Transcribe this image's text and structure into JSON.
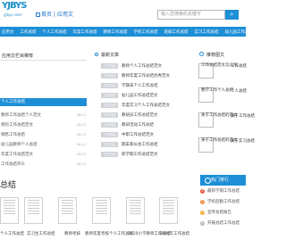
{
  "header": {
    "logo_text": "YJBYS",
    "logo_sub": "yjbys.com",
    "home_label": "首页 | 应用文",
    "search_placeholder": "输入您搜索的关键字",
    "search_button": "⌕"
  },
  "nav": [
    "应用文",
    "工作总结",
    "个人工作总结",
    "年度工作总结",
    "教师工作总结",
    "学校工作总结",
    "班级工作总结",
    "实习工作总结",
    "幼儿园工作总结",
    "班主任工作"
  ],
  "left": {
    "title": "应用文栏目推荐",
    "highlight": "个人工作总结",
    "items": [
      {
        "text": "教师工作总结个人范文",
        "date": "08-11"
      },
      {
        "text": "保险工作总结范文",
        "date": "08-11"
      },
      {
        "text": "销售工作总结",
        "date": "08-11"
      },
      {
        "text": "幼儿园教师个人总结",
        "date": "08-11"
      },
      {
        "text": "年度工作总结范文",
        "date": "08-11"
      },
      {
        "text": "工作总结开头",
        "date": "08-11"
      }
    ]
  },
  "middle": {
    "title": "最新文章",
    "items": [
      {
        "tag": "工作总结",
        "text": "教师个人工作总结范文"
      },
      {
        "tag": "工作总结",
        "text": "教师年度工作总结优秀范文"
      },
      {
        "tag": "工作总结",
        "text": "学期末个人工作总结"
      },
      {
        "tag": "工作总结",
        "text": "幼儿园工作总结范文"
      },
      {
        "tag": "工作总结",
        "text": "年度实习个人工作总结范文"
      },
      {
        "tag": "工作总结",
        "text": "教研员工作总结范文"
      },
      {
        "tag": "工作总结",
        "text": "教研活动工作总结"
      },
      {
        "tag": "工作总结",
        "text": "中职工作总结范文"
      },
      {
        "tag": "工作总结",
        "text": "期末家长会工作总结"
      },
      {
        "tag": "工作总结",
        "text": "新学期工作总结范文"
      }
    ]
  },
  "right": {
    "title": "推荐图文",
    "items": [
      {
        "text1": "工作总结范文怎么写",
        "text2": "工作总结"
      },
      {
        "text1": "教学工作个人总结",
        "text2": "个人总结"
      },
      {
        "text1": "关于工作总结的范文",
        "text2": "关于工作总结"
      },
      {
        "text1": "关于工作总结的范文",
        "text2": "关于实习总结"
      }
    ]
  },
  "bottom": {
    "title": "总结",
    "captions": [
      "个人工作总结",
      "实习生工作总结",
      "教师考核",
      "教师年度考核个人工作总结",
      "2020小学教师工作总结",
      "2020年工作总结"
    ]
  },
  "hot": {
    "title": "热门排行",
    "items": [
      "最新学期工作总结",
      "学校后勤工作总结",
      "宣传总结报告",
      "开展总结工作总结"
    ],
    "colors": [
      "#e85a3c",
      "#f08a3a",
      "#f0b03a",
      "#b9b9b9"
    ]
  }
}
